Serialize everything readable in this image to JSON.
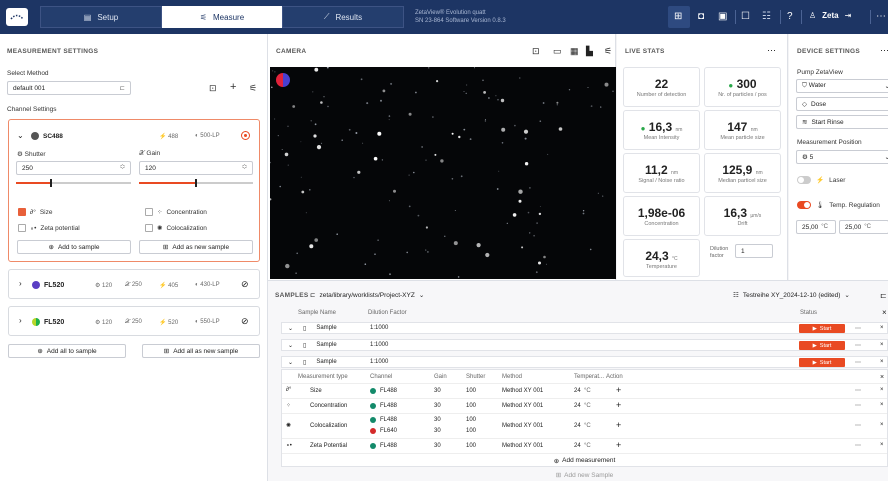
{
  "topbar": {
    "tabs": [
      {
        "label": "Setup"
      },
      {
        "label": "Measure"
      },
      {
        "label": "Results"
      }
    ],
    "version_line1": "ZetaView® Evolution quatt",
    "version_line2": "SN 23-864  Software Version 0.8.3",
    "user": "Zeta"
  },
  "measurement_settings": {
    "title": "MEASUREMENT SETTINGS",
    "select_method_label": "Select Method",
    "method_value": "default 001",
    "channel_settings_label": "Channel Settings",
    "channel1": {
      "name": "SC488",
      "wavelength": "488",
      "filter": "500-LP",
      "shutter_label": "Shutter",
      "gain_label": "Gain",
      "shutter_value": "250",
      "gain_value": "120",
      "shutter_level": 0.3,
      "gain_level": 0.5,
      "checks": [
        {
          "label": "Size",
          "checked": true
        },
        {
          "label": "Concentration",
          "checked": false
        },
        {
          "label": "Zeta potential",
          "checked": false
        },
        {
          "label": "Colocalization",
          "checked": false
        }
      ],
      "add_to_sample": "Add to sample",
      "add_as_new_sample": "Add as new sample"
    },
    "channel2": {
      "name": "FL520",
      "shutter": "120",
      "gain": "250",
      "wavelength": "405",
      "filter": "430-LP"
    },
    "channel3": {
      "name": "FL520",
      "shutter": "120",
      "gain": "250",
      "wavelength": "520",
      "filter": "550-LP"
    },
    "add_all_to_sample": "Add all to sample",
    "add_all_as_new_sample": "Add all as new sample"
  },
  "camera": {
    "title": "CAMERA"
  },
  "live_stats": {
    "title": "LIVE STATS",
    "stats": [
      {
        "value": "22",
        "unit": "",
        "label": "Number of detection"
      },
      {
        "value": "300",
        "unit": "",
        "label": "Nr. of particles / pos"
      },
      {
        "value": "16,3",
        "unit": "nm",
        "label": "Mean Intensity"
      },
      {
        "value": "147",
        "unit": "nm",
        "label": "Mean particle size"
      },
      {
        "value": "11,2",
        "unit": "nm",
        "label": "Signal / Noise ratio"
      },
      {
        "value": "125,9",
        "unit": "nm",
        "label": "Median particel size"
      },
      {
        "value": "1,98e-06",
        "unit": "",
        "label": "Concentration"
      },
      {
        "value": "16,3",
        "unit": "µm/s",
        "label": "Drift"
      },
      {
        "value": "24,3",
        "unit": "°C",
        "label": "Temperature"
      }
    ],
    "dilution_label_1": "Dilution",
    "dilution_label_2": "factor",
    "dilution_value": "1"
  },
  "device_settings": {
    "title": "DEVICE SETTINGS",
    "pump_label": "Pump ZetaView",
    "pump_value": "Water",
    "dose": "Dose",
    "start_rinse": "Start Rinse",
    "position_label": "Measurement Position",
    "position_value": "5",
    "laser": "Laser",
    "laser_on": false,
    "temp_regulation": "Temp. Regulation",
    "temp_on": true,
    "temp1": "25,00",
    "temp2": "25,00",
    "temp_unit": "°C"
  },
  "samples": {
    "title": "SAMPLES",
    "path": "zeta/library/worklists/Project-XYZ",
    "run_name": "Testreihe XY_2024-12-10 (edited)",
    "col_sample_name": "Sample Name",
    "col_dilution": "Dilution Factor",
    "col_status": "Status",
    "rows": [
      {
        "name": "Sample",
        "dilution": "1:1000",
        "start": "Start"
      },
      {
        "name": "Sample",
        "dilution": "1:1000",
        "start": "Start"
      },
      {
        "name": "Sample",
        "dilution": "1:1000",
        "start": "Start"
      }
    ],
    "sub_headers": [
      "Measurement type",
      "Channel",
      "Gain",
      "Shutter",
      "Method",
      "Temperat...",
      "Action"
    ],
    "measurements": [
      {
        "type": "Size",
        "channel": "FL488",
        "gain": "30",
        "shutter": "100",
        "method": "Method XY 001",
        "temp": "24",
        "unit": "°C"
      },
      {
        "type": "Concentration",
        "channel": "FL488",
        "gain": "30",
        "shutter": "100",
        "method": "Method XY 001",
        "temp": "24",
        "unit": "°C"
      },
      {
        "type": "Colocalization",
        "channel": "FL488",
        "channel2": "FL640",
        "gain": "30",
        "gain2": "30",
        "shutter": "100",
        "shutter2": "100",
        "method": "Method XY 001",
        "temp": "24",
        "unit": "°C"
      },
      {
        "type": "Zeta Potential",
        "channel": "FL488",
        "gain": "30",
        "shutter": "100",
        "method": "Method XY 001",
        "temp": "24",
        "unit": "°C"
      }
    ],
    "add_measurement": "Add measurement",
    "add_new_sample": "Add new Sample"
  }
}
